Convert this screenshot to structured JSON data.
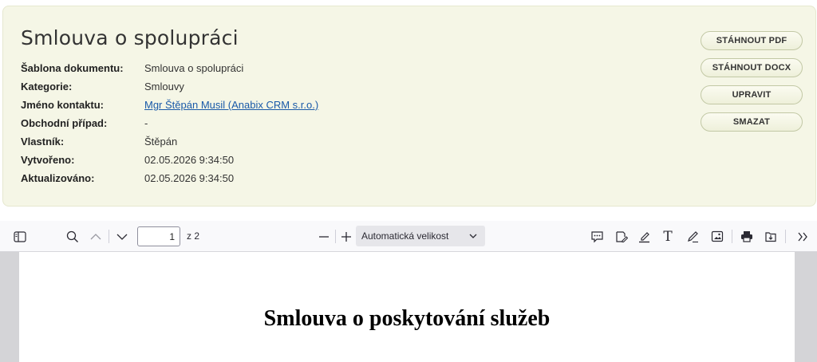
{
  "document": {
    "title": "Smlouva o spolupráci",
    "fields": [
      {
        "label": "Šablona dokumentu:",
        "value": "Smlouva o spolupráci",
        "link": false
      },
      {
        "label": "Kategorie:",
        "value": "Smlouvy",
        "link": false
      },
      {
        "label": "Jméno kontaktu:",
        "value": "Mgr Štěpán Musil (Anabix CRM s.r.o.)",
        "link": true
      },
      {
        "label": "Obchodní případ:",
        "value": "-",
        "link": false
      },
      {
        "label": "Vlastník:",
        "value": "Štěpán",
        "link": false
      },
      {
        "label": "Vytvořeno:",
        "value": "02.05.2026 9:34:50",
        "link": false
      },
      {
        "label": "Aktualizováno:",
        "value": "02.05.2026 9:34:50",
        "link": false
      }
    ]
  },
  "actions": {
    "download_pdf": "STÁHNOUT PDF",
    "download_docx": "STÁHNOUT DOCX",
    "edit": "UPRAVIT",
    "delete": "SMAZAT"
  },
  "pdf_viewer": {
    "page_number": "1",
    "page_total": "z 2",
    "zoom": "Automatická velikost",
    "icons": [
      "sidebar-toggle-icon",
      "search-icon",
      "chevron-up-icon",
      "chevron-down-icon",
      "zoom-out-icon",
      "zoom-in-icon",
      "comment-icon",
      "signature-icon",
      "highlight-icon",
      "text-icon",
      "draw-icon",
      "image-icon",
      "print-icon",
      "save-icon",
      "more-tools-icon"
    ]
  },
  "pdf_page": {
    "heading": "Smlouva o poskytování služeb"
  },
  "colors": {
    "panel_bg": "#f5f6e6",
    "link": "#1a5aa8",
    "viewer_bg": "#d4d4d7",
    "toolbar_bg": "#f9f9fb"
  }
}
